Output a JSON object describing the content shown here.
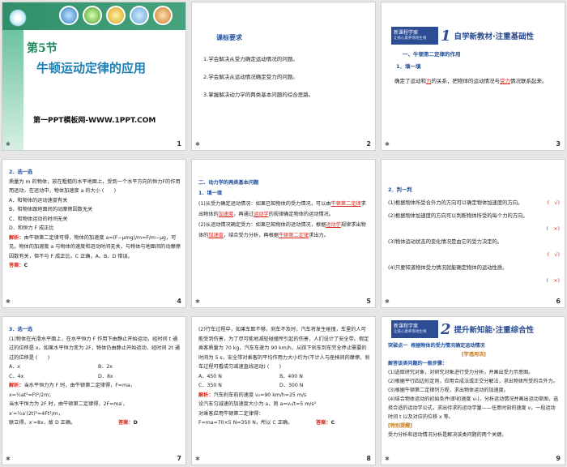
{
  "slides": {
    "s1": {
      "number": "1",
      "section": "第5节",
      "title": "牛顿运动定律的应用",
      "footer": "第一PPT模板网-WWW.1PPT.COM"
    },
    "s2": {
      "number": "2",
      "heading": "课标要求",
      "items": [
        "1.学会解决从受力确定运动情况的问题。",
        "2.学会解决从运动情况确定受力的问题。",
        "3.掌握解决动力学的两类基本问题的综合思路。"
      ]
    },
    "s3": {
      "number": "3",
      "banner_cn": "新课程学案",
      "banner_en": "让核心素养落地生根",
      "banner_num": "1",
      "banner_title": "自学新教材·注重基础性",
      "sub": "一、牛顿第二定律的作用",
      "fill": "1．填一填",
      "para_a": "确定了运动和",
      "blank1": "力",
      "para_b": "的关系，把物体的运动情况与",
      "blank2": "受力",
      "para_c": "情况联系起来。"
    },
    "s4": {
      "number": "4",
      "label": "2．选一选",
      "q": "质量为 m 的物体，放在粗糙的水平地面上，受到一个水平方向的恒力F的作用而运动，在运动中，物体加速度 a 的大小",
      "paren": "(　　)",
      "A": "A．和物体的运动速度有关",
      "B": "B．和物体跟地面间的动摩擦因数无关",
      "C": "C．和物体运动的时间无关",
      "D": "D．和恒力 F 成正比",
      "analysis_label": "解析：",
      "analysis": "由牛顿第二定律可得，物体的加速度 a=(F−μmg)/m=F/m−μg，可见，物体的加速度 a 与物体的速度和运动时间无关，与物体与地面间的动摩擦因数有关，但不与 F 成正比，C 正确，A、B、D 错误。",
      "answer_label": "答案：",
      "answer": "C"
    },
    "s5": {
      "number": "5",
      "heading": "二、动力学的两类基本问题",
      "fill": "1．填一填",
      "p1a": "(1)从受力确定运动情况：如果已知物体的受力情况，可以由",
      "p1b": "牛顿第二定律",
      "p1c": "求出物体的",
      "p1d": "加速度",
      "p1e": "，再通过",
      "p1f": "运动学",
      "p1g": "的规律确定物体的运动情况。",
      "p2a": "(2)从运动情况确定受力：如果已知物体的运动情况，根据",
      "p2b": "运动学",
      "p2c": "规律求出物体的",
      "p2d": "加速度",
      "p2e": "，结合受力分析，再根据",
      "p2f": "牛顿第二定律",
      "p2g": "求出力。"
    },
    "s6": {
      "number": "6",
      "label": "2．判一判",
      "items": [
        {
          "text": "(1)根据物体所受合外力的方向可以确定物体加速度的方向。",
          "ans": "(　√)"
        },
        {
          "text": "(2)根据物体加速度的方向可以判断物体所受的每个力的方向。",
          "ans": "(　×)"
        },
        {
          "text": "(3)物体运动状态的变化情况是由它的受力决定的。",
          "ans": "(　√)"
        },
        {
          "text": "(4)只要知道物体受力情况就能确定物体的运动性质。",
          "ans": "(　×)"
        }
      ]
    },
    "s7": {
      "number": "7",
      "label": "3．选一选",
      "q": "(1)物体在光滑水平面上，在水平恒力 F 作用下由静止开始运动，经时间 t 通过的位移是 x。如果水平恒力变为 2F，物体仍由静止开始运动，经时间 2t 通过的位移是",
      "paren": "(　　)",
      "A": "A．x",
      "B": "B．2x",
      "C": "C．4x",
      "D": "D．8x",
      "analysis_label": "解析：",
      "a1": "当水平恒力为 F 时，由牛顿第二定律得，F=ma，",
      "a2": "x=½at²=Ft²/2m；",
      "a3": "当水平恒力为 2F 时，由牛顿第二定律得，2F=ma′，",
      "a4": "x′=½a′(2t)²=4Ft²/m，",
      "a5": "联立得，x′=8x，故 D 正确。",
      "answer_label": "答案：",
      "answer": "D"
    },
    "s8": {
      "number": "8",
      "q": "(2)行车过程中，如果车距不够，刹车不及时，汽车将发生碰撞，车里的人可能受到伤害，为了尽可能地减轻碰撞所引起的伤害，人们设计了安全带。假定乘客质量为 70 kg，汽车车速为 90 km/h，从踩下刹车到车完全停止需要的时间为 5 s，安全带对乘客的平均作用力大小约为(不计人与座椅间的摩擦，刹车过程可看成匀减速直线运动)",
      "paren": "(　　)",
      "A": "A．450 N",
      "B": "B．400 N",
      "C": "C．350 N",
      "D": "D．300 N",
      "analysis_label": "解析：",
      "a1": "汽车刹车前的速度 v₀=90 km/h=25 m/s",
      "a2": "设汽车匀减速的加速度大小为 a，则 a=v₀/t=5 m/s²",
      "a3": "对乘客应用牛顿第二定律得：",
      "a4": "F=ma=70×5 N=350 N，所以 C 正确。",
      "answer_label": "答案：",
      "answer": "C"
    },
    "s9": {
      "number": "9",
      "banner_cn": "新课程学案",
      "banner_en": "让核心素养落地生根",
      "banner_num": "2",
      "banner_title": "提升新知能·注重综合性",
      "point_label": "突破点一",
      "point": "根据物体的受力情况确定运动情况",
      "tag": "[学透用活]",
      "sub": "解答该类问题的一般步骤：",
      "s1": "(1)选取研究对象，对研究对象进行受力分析，并画出受力示意图。",
      "s2": "(2)根据平行四边形定则，应用合成法或正交分解法，求出物体所受的合外力。",
      "s3": "(3)根据牛顿第二定律列方程，求出物体运动的加速度。",
      "s4": "(4)结合物体运动的初始条件(即初速度 v₀)，分析运动情况并画出运动草图，选择合适的运动学公式，求出待求的运动学量——任意时刻的速度 v，一段运动时间 t 以及对应的位移 x 等。",
      "tag2": "[特别提醒]",
      "note": "受力分析和运动情况分析是解决该类问题的两个关键。"
    }
  }
}
